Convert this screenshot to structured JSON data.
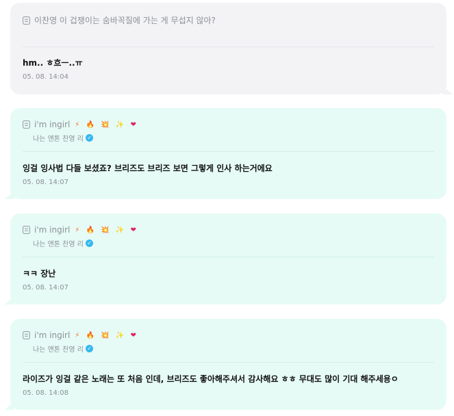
{
  "messages": [
    {
      "question": "이찬영 이 겁쟁이는 숨바꼭질에 가는 게 무섭지 않아?",
      "text": "hm.. ㅎ흐ㅡ..ㅠ",
      "time": "05. 08. 14:04"
    },
    {
      "name": "i'm ingirl",
      "emojis": [
        "⚡",
        "🔥",
        "💥",
        "✨",
        "❤"
      ],
      "subtitle": "나는 앤톤 찬영 리",
      "text": "잉걸 잉사법 다들 보셨죠? 브리즈도 브리즈 보면 그렇게 인사 하는거에요",
      "time": "05. 08. 14:07"
    },
    {
      "name": "i'm ingirl",
      "emojis": [
        "⚡",
        "🔥",
        "💥",
        "✨",
        "❤"
      ],
      "subtitle": "나는 앤톤 찬영 리",
      "text": "ㅋㅋ 장난",
      "time": "05. 08. 14:07"
    },
    {
      "name": "i'm ingirl",
      "emojis": [
        "⚡",
        "🔥",
        "💥",
        "✨",
        "❤"
      ],
      "subtitle": "나는 앤톤 찬영 리",
      "text": "라이즈가 잉걸 같은 노래는 또 처음 인데, 브리즈도 좋아해주셔서 감사해요 ㅎㅎ 무대도 많이 기대 해주세용ㅇ",
      "time": "05. 08. 14:08"
    }
  ],
  "colors": {
    "question_bubble": "#f3f3f5",
    "reply_bubble": "#e6fbf5",
    "muted_text": "#8b8f96",
    "verified_badge": "#36b6f0"
  },
  "icons": {
    "memo": "memo-icon",
    "verified": "verified-check-icon"
  }
}
